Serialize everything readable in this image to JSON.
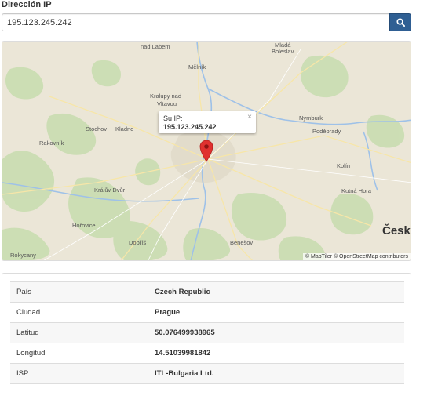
{
  "ip_section": {
    "label": "Dirección IP",
    "value": "195.123.245.242"
  },
  "map": {
    "popup_caption": "Su IP:",
    "popup_ip": "195.123.245.242",
    "popup_close": "×",
    "attribution": "© MapTiler © OpenStreetMap contributors",
    "places": [
      {
        "name": "nad Labem"
      },
      {
        "name": "Mladá"
      },
      {
        "name": "Boleslav"
      },
      {
        "name": "Mělník"
      },
      {
        "name": "Kralupy nad"
      },
      {
        "name": "Vltavou"
      },
      {
        "name": "Stochov"
      },
      {
        "name": "Kladno"
      },
      {
        "name": "Nymburk"
      },
      {
        "name": "Poděbrady"
      },
      {
        "name": "Rakovník"
      },
      {
        "name": "Kolín"
      },
      {
        "name": "Česko"
      },
      {
        "name": "Králův Dvůr"
      },
      {
        "name": "Kutná Hora"
      },
      {
        "name": "Hořovice"
      },
      {
        "name": "Dobříš"
      },
      {
        "name": "Benešov"
      },
      {
        "name": "Rokycany"
      }
    ]
  },
  "info": {
    "rows": [
      {
        "key": "País",
        "value": "Czech Republic"
      },
      {
        "key": "Ciudad",
        "value": "Prague"
      },
      {
        "key": "Latitud",
        "value": "50.076499938965"
      },
      {
        "key": "Longitud",
        "value": "14.51039981842"
      },
      {
        "key": "ISP",
        "value": "ITL-Bulgaria Ltd."
      }
    ]
  }
}
